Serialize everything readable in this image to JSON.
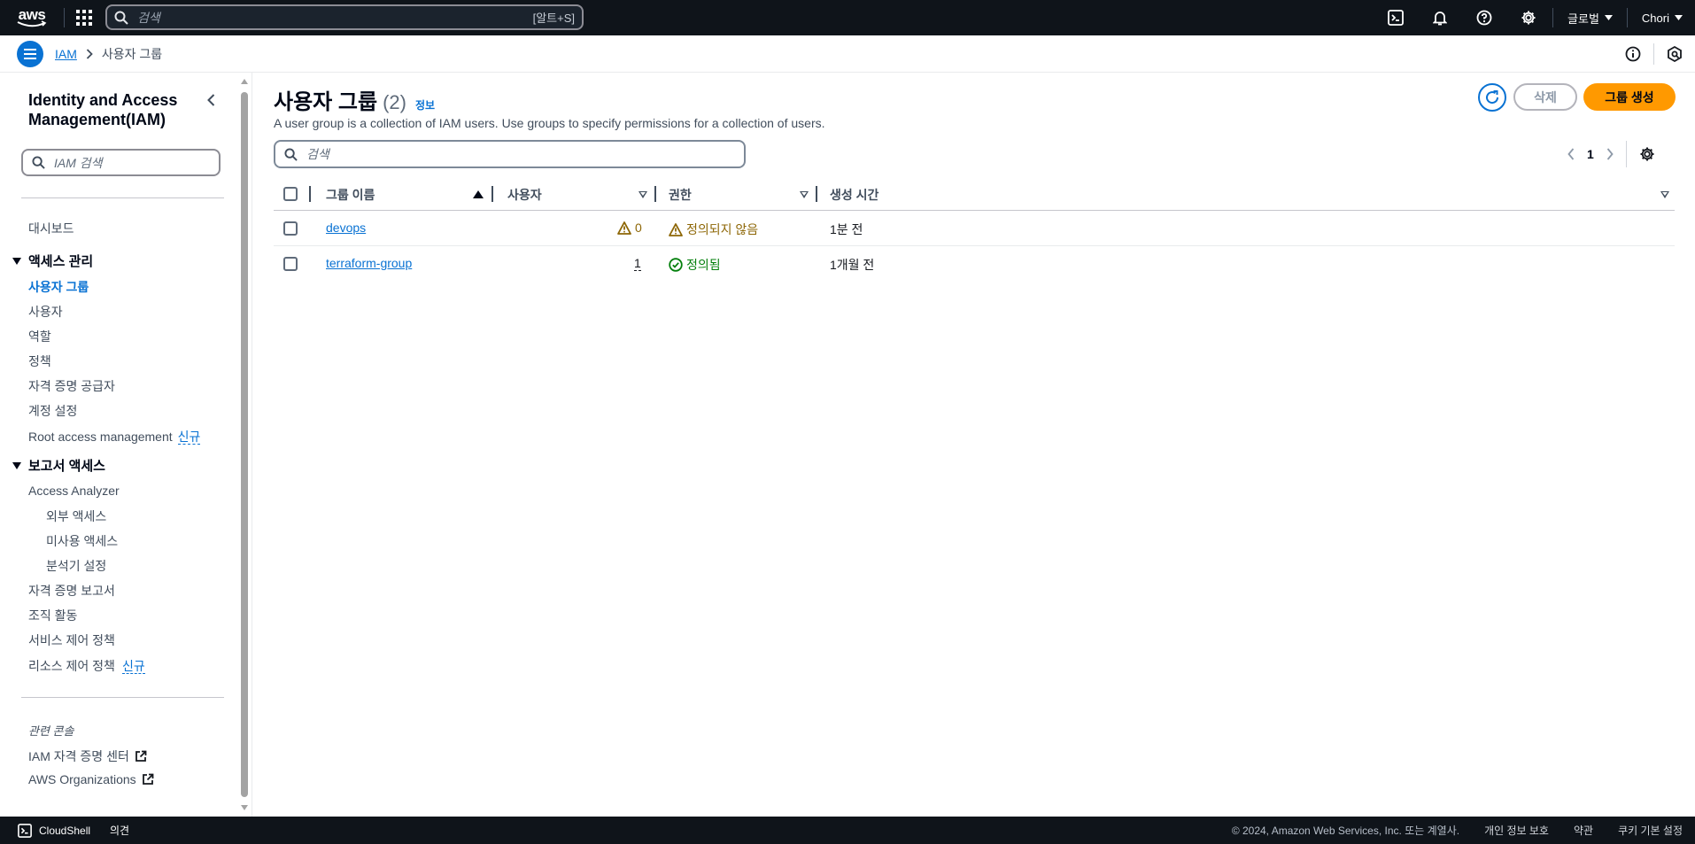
{
  "topnav": {
    "logo_text": "aws",
    "search_placeholder": "검색",
    "search_shortcut": "[알트+S]",
    "region": "글로벌",
    "user": "Chori",
    "icons": [
      "apps-grid-icon",
      "cloudshell-icon",
      "bell-icon",
      "help-icon",
      "gear-icon"
    ]
  },
  "breadcrumb": {
    "items": [
      {
        "label": "IAM"
      },
      {
        "label": "사용자 그룹"
      }
    ]
  },
  "sidebar": {
    "title": "Identity and Access Management(IAM)",
    "search_placeholder": "IAM 검색",
    "dashboard": "대시보드",
    "access_mgmt": {
      "label": "액세스 관리",
      "items": [
        "사용자 그룹",
        "사용자",
        "역할",
        "정책",
        "자격 증명 공급자",
        "계정 설정"
      ],
      "root_access": "Root access management",
      "new_badge": "신규"
    },
    "report_access": {
      "label": "보고서 액세스",
      "analyzer": "Access Analyzer",
      "analyzer_items": [
        "외부 액세스",
        "미사용 액세스",
        "분석기 설정"
      ],
      "items": [
        "자격 증명 보고서",
        "조직 활동",
        "서비스 제어 정책"
      ],
      "resource_policy": "리소스 제어 정책",
      "new_badge": "신규"
    },
    "related": {
      "label": "관련 콘솔",
      "items": [
        "IAM 자격 증명 센터",
        "AWS Organizations"
      ]
    }
  },
  "main": {
    "title": "사용자 그룹",
    "count": "(2)",
    "info": "정보",
    "description": "A user group is a collection of IAM users. Use groups to specify permissions for a collection of users.",
    "search_placeholder": "검색",
    "delete_label": "삭제",
    "create_label": "그룹 생성",
    "page": "1",
    "columns": [
      "그룹 이름",
      "사용자",
      "권한",
      "생성 시간"
    ],
    "rows": [
      {
        "name": "devops",
        "users": "0",
        "users_warning": true,
        "permission": "정의되지 않음",
        "permission_status": "warning",
        "created": "1분 전"
      },
      {
        "name": "terraform-group",
        "users": "1",
        "users_warning": false,
        "permission": "정의됨",
        "permission_status": "success",
        "created": "1개월 전"
      }
    ]
  },
  "footer": {
    "cloudshell": "CloudShell",
    "feedback": "의견",
    "copyright": "© 2024, Amazon Web Services, Inc. 또는 계열사.",
    "privacy": "개인 정보 보호",
    "terms": "약관",
    "cookies": "쿠키 기본 설정"
  },
  "colors": {
    "nav_bg": "#0f141a",
    "link": "#0972d3",
    "primary_button": "#ff9900",
    "warning": "#8d6605",
    "success": "#037f0c"
  }
}
